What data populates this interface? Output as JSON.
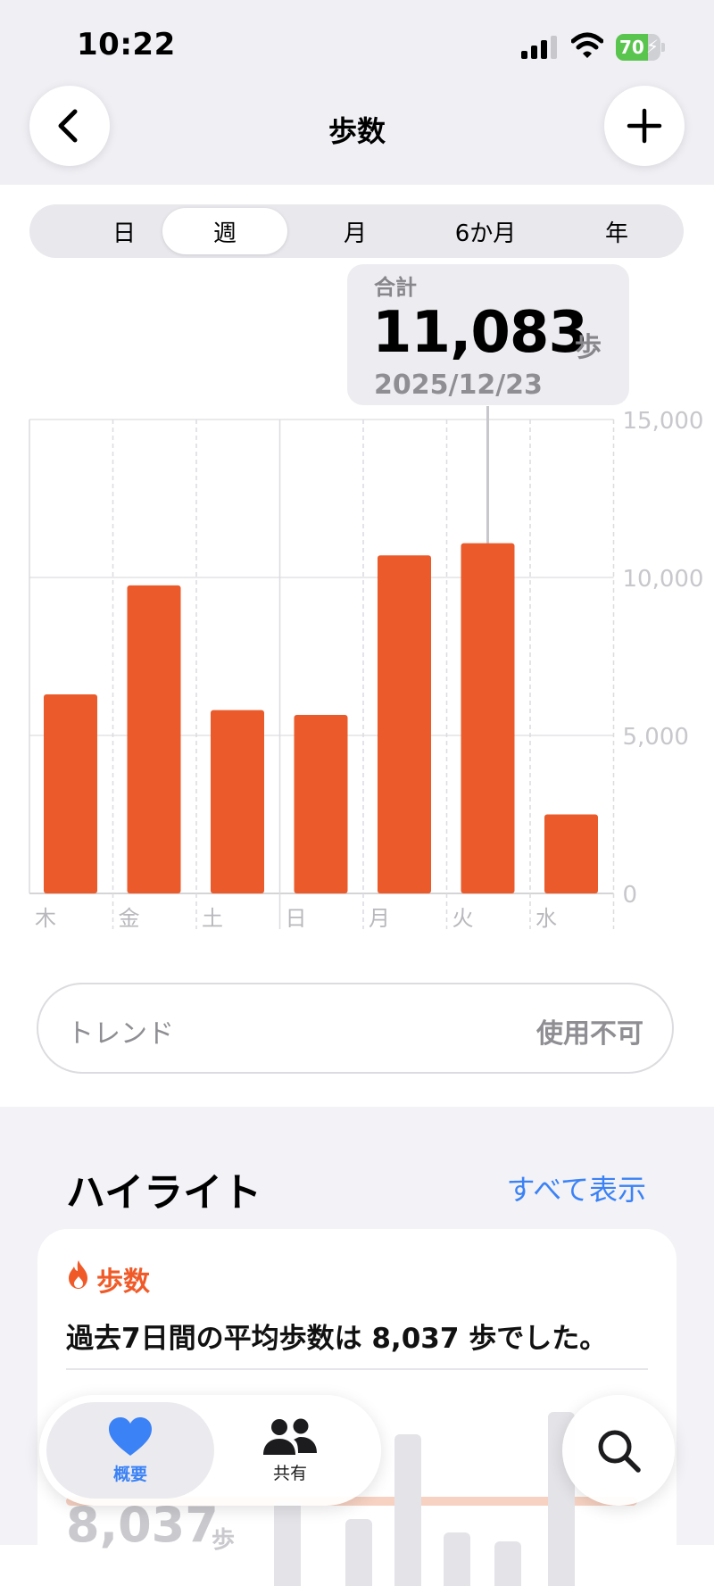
{
  "status_bar": {
    "time": "10:22",
    "battery": "70"
  },
  "header": {
    "title": "歩数"
  },
  "segments": [
    "日",
    "週",
    "月",
    "6か月",
    "年"
  ],
  "selected_segment": "週",
  "tooltip": {
    "label": "合計",
    "value": "11,083",
    "unit": "歩",
    "date": "2025/12/23"
  },
  "chart_data": {
    "type": "bar",
    "categories": [
      "木",
      "金",
      "土",
      "日",
      "月",
      "火",
      "水"
    ],
    "values": [
      6300,
      9750,
      5800,
      5650,
      10700,
      11083,
      2500
    ],
    "y_ticks": [
      "15,000",
      "10,000",
      "5,000",
      "0"
    ],
    "ylim": [
      0,
      15000
    ],
    "highlighted_category": "火",
    "bar_color": "#eb5a2a",
    "grid": true
  },
  "trend": {
    "label": "トレンド",
    "status": "使用不可"
  },
  "highlights": {
    "title": "ハイライト",
    "show_all": "すべて表示",
    "card": {
      "category": "歩数",
      "text": "過去7日間の平均歩数は 8,037 歩でした。",
      "avg_value": "8,037",
      "avg_unit": "歩"
    }
  },
  "tab_bar": {
    "items": [
      {
        "label": "概要",
        "icon": "heart-icon",
        "active": true
      },
      {
        "label": "共有",
        "icon": "people-icon",
        "active": false
      }
    ]
  },
  "colors": {
    "accent_blue": "#3b82f6",
    "steps_orange": "#eb5a2a"
  }
}
